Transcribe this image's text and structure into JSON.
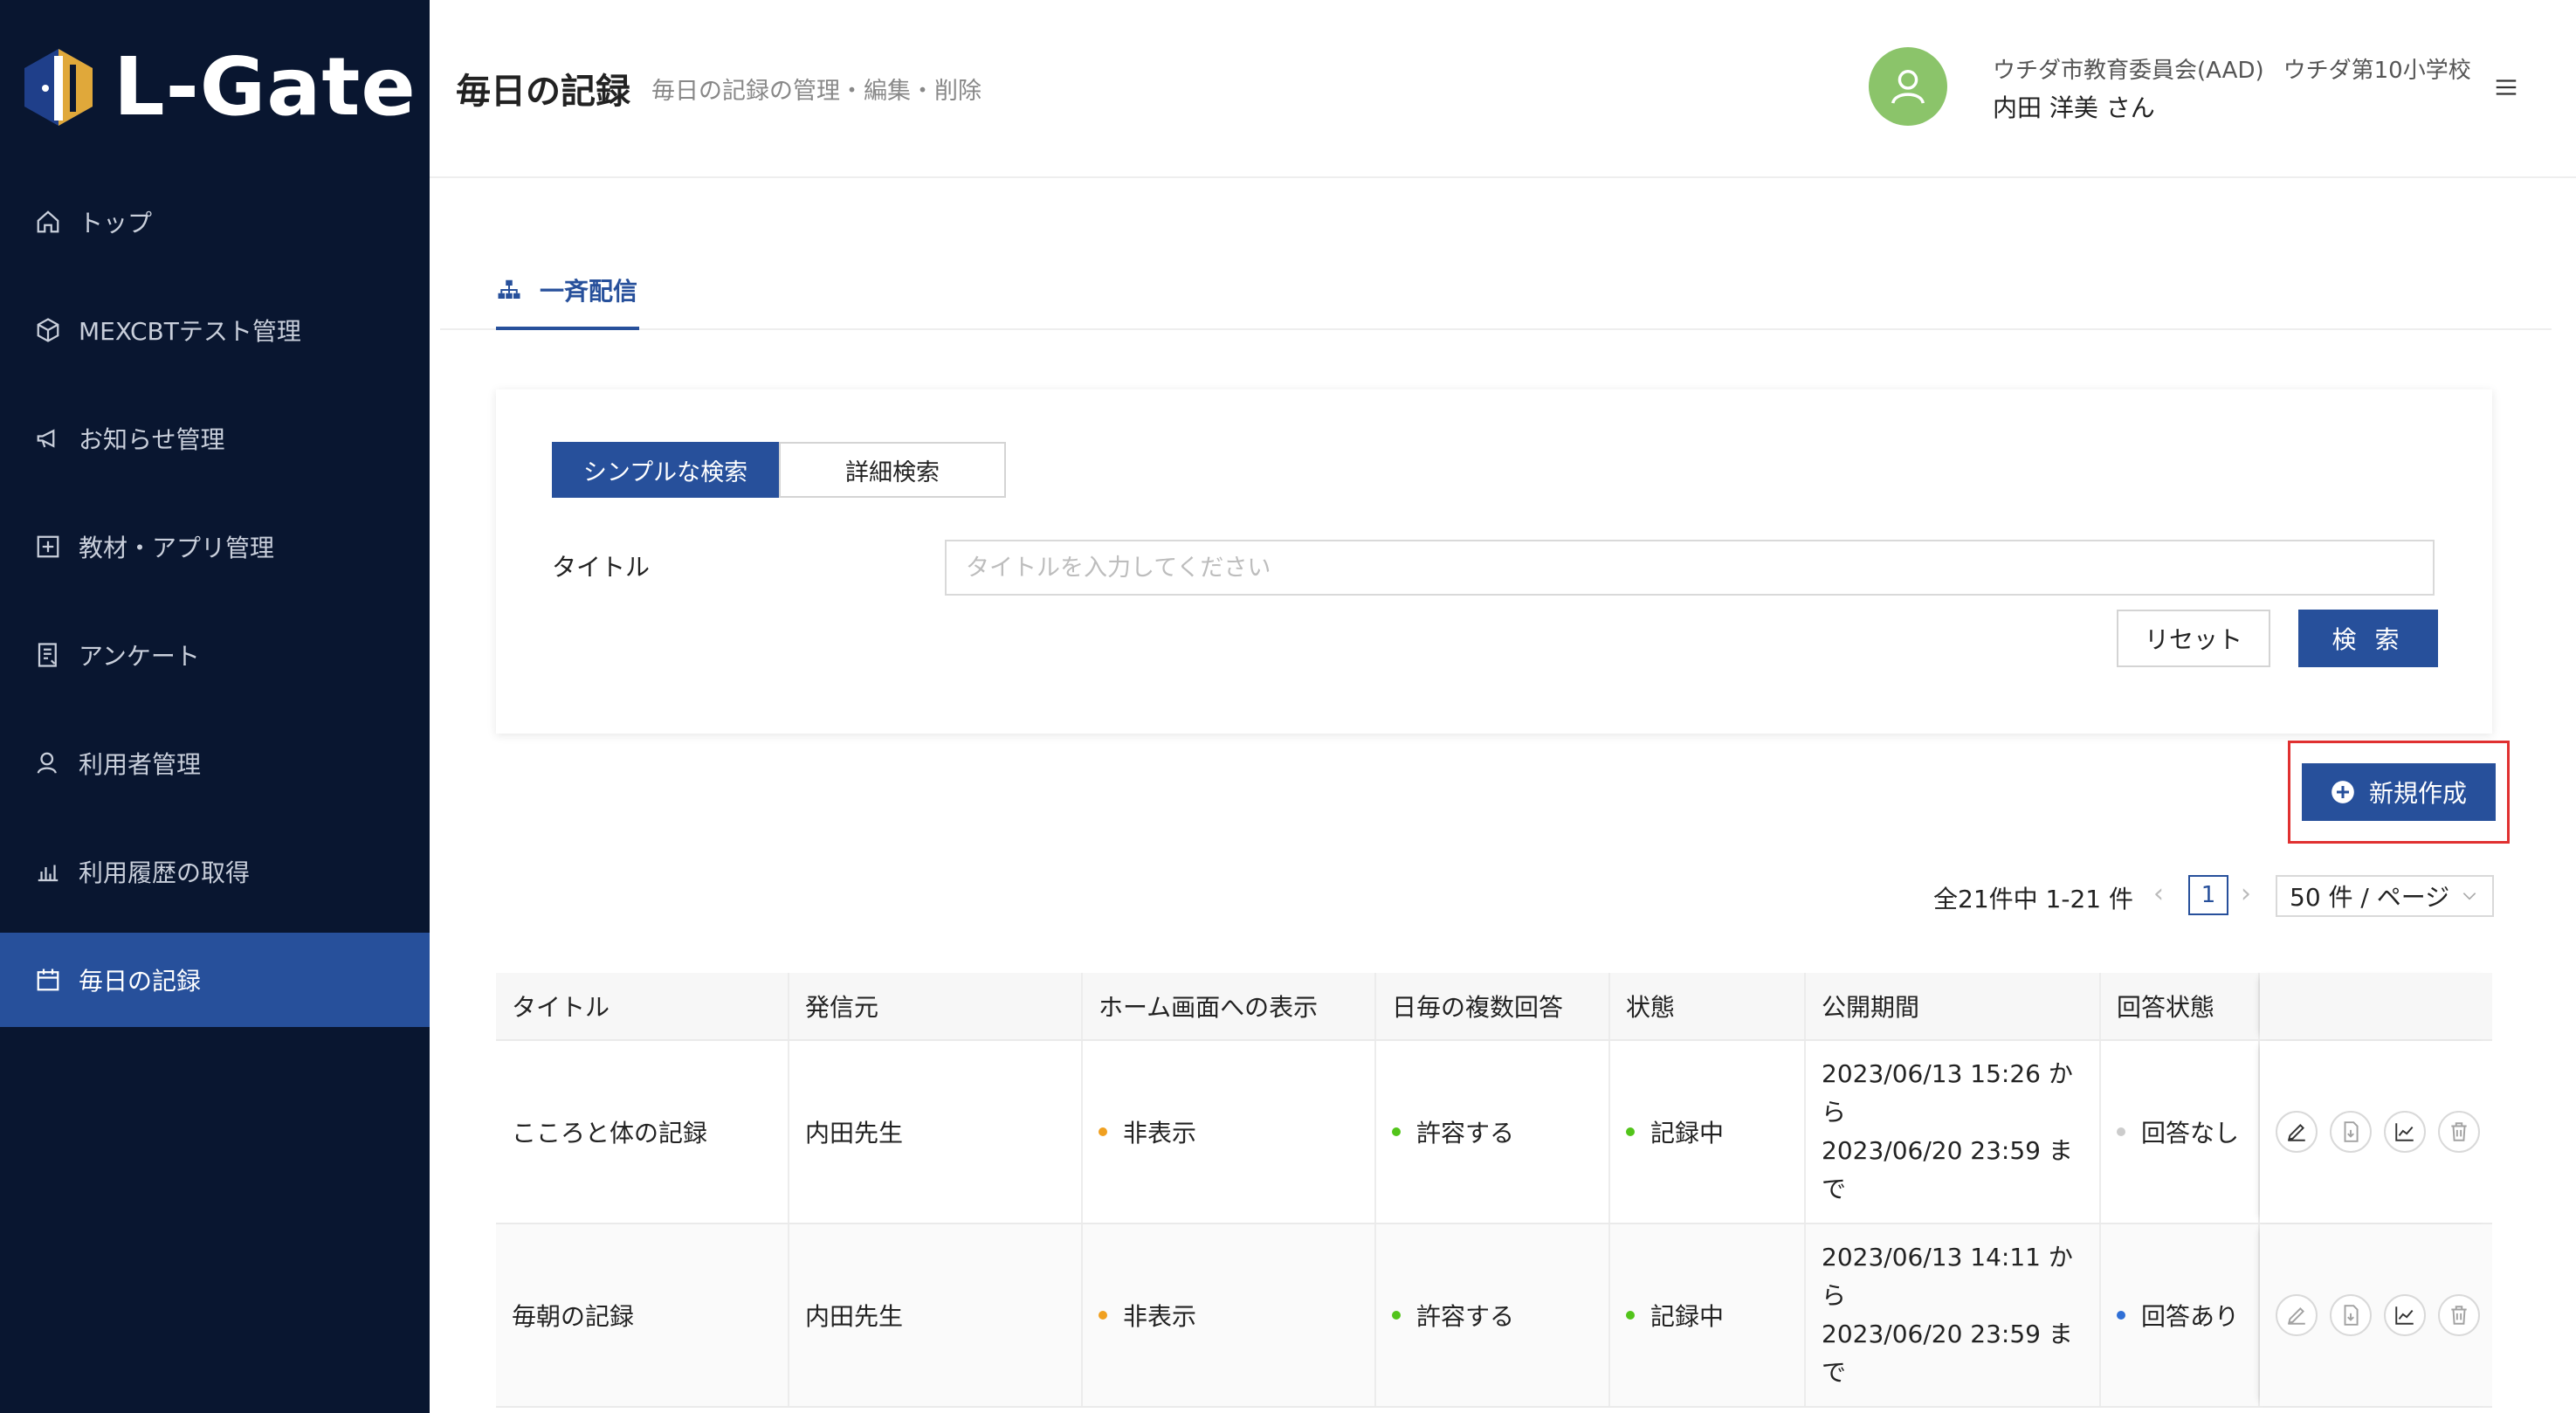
{
  "sidebar": {
    "logo_text": "L-Gate",
    "items": [
      {
        "label": "トップ",
        "icon": "home-icon"
      },
      {
        "label": "MEXCBTテスト管理",
        "icon": "cube-icon"
      },
      {
        "label": "お知らせ管理",
        "icon": "megaphone-icon"
      },
      {
        "label": "教材・アプリ管理",
        "icon": "plus-square-icon"
      },
      {
        "label": "アンケート",
        "icon": "survey-icon"
      },
      {
        "label": "利用者管理",
        "icon": "user-icon"
      },
      {
        "label": "利用履歴の取得",
        "icon": "bar-chart-icon"
      },
      {
        "label": "毎日の記録",
        "icon": "calendar-icon",
        "active": true
      }
    ]
  },
  "header": {
    "title": "毎日の記録",
    "subtitle": "毎日の記録の管理・編集・削除",
    "org": "ウチダ市教育委員会(AAD)",
    "school": "ウチダ第10小学校",
    "user_name": "内田 洋美 さん"
  },
  "tabs": [
    {
      "label": "一斉配信",
      "icon": "sitemap-icon"
    }
  ],
  "search": {
    "simple_label": "シンプルな検索",
    "detail_label": "詳細検索",
    "title_label": "タイトル",
    "title_placeholder": "タイトルを入力してください",
    "title_value": "",
    "reset_label": "リセット",
    "search_label": "検 索"
  },
  "new_button_label": "新規作成",
  "pagination": {
    "total_text": "全21件中 1-21 件",
    "current_page": "1",
    "per_page": "50 件 / ページ"
  },
  "table": {
    "headers": [
      "タイトル",
      "発信元",
      "ホーム画面への表示",
      "日毎の複数回答",
      "状態",
      "公開期間",
      "回答状態",
      ""
    ],
    "rows": [
      {
        "title": "こころと体の記録",
        "sender": "内田先生",
        "home_display": "非表示",
        "multi_answer": "許容する",
        "status": "記録中",
        "period_line1": "2023/06/13 15:26 か",
        "period_line2": "ら",
        "period_line3": "2023/06/20 23:59 ま",
        "period_line4": "で",
        "answer_state": "回答なし",
        "answer_dot": "#cccccc",
        "edit_enabled": true
      },
      {
        "title": "毎朝の記録",
        "sender": "内田先生",
        "home_display": "非表示",
        "multi_answer": "許容する",
        "status": "記録中",
        "period_line1": "2023/06/13 14:11 か",
        "period_line2": "ら",
        "period_line3": "2023/06/20 23:59 ま",
        "period_line4": "で",
        "answer_state": "回答あり",
        "answer_dot": "#2f6fd6",
        "edit_enabled": false
      }
    ]
  },
  "colors": {
    "sidebar_bg": "#091630",
    "accent": "#27509b",
    "avatar": "#8bc46a",
    "dot_hidden": "#f0a020",
    "dot_ok": "#52c41a",
    "highlight_frame": "#e03030"
  }
}
